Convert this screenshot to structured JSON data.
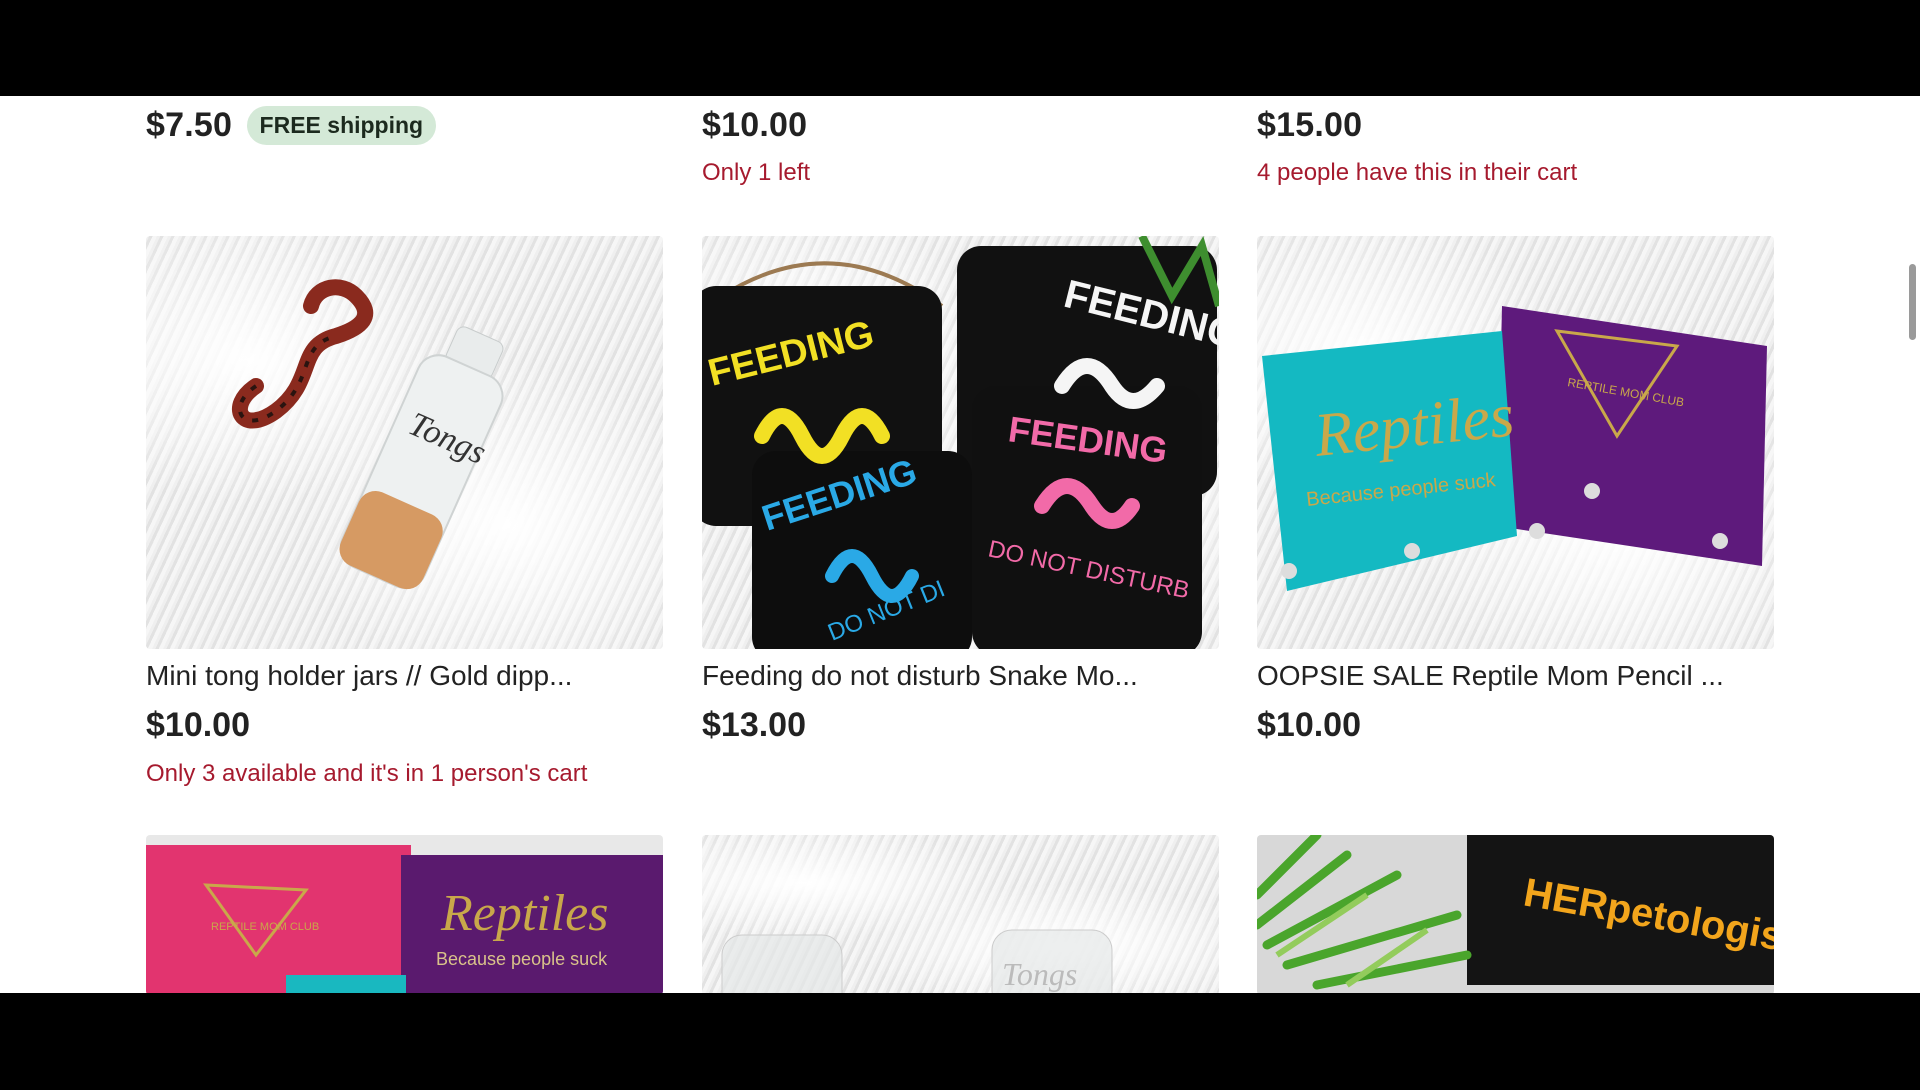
{
  "previous_row": [
    {
      "price": "$7.50",
      "badge": "FREE shipping",
      "note": ""
    },
    {
      "price": "$10.00",
      "badge": "",
      "note": "Only 1 left"
    },
    {
      "price": "$15.00",
      "badge": "",
      "note": "4 people have this in their cart"
    }
  ],
  "listings": [
    {
      "title": "Mini tong holder jars // Gold dipp...",
      "price": "$10.00",
      "note": "Only 3 available and it's in 1 person's cart",
      "image_text": [
        "Tongs"
      ]
    },
    {
      "title": "Feeding do not disturb Snake Mo...",
      "price": "$13.00",
      "note": "",
      "image_text": [
        "FEEDING",
        "FEEDING",
        "FEEDING",
        "FEEDING",
        "DO NOT DISTURB",
        "DO NOT DI"
      ]
    },
    {
      "title": "OOPSIE SALE Reptile Mom Pencil ...",
      "price": "$10.00",
      "note": "",
      "image_text": [
        "Reptiles",
        "Because people suck",
        "REPTILE MOM CLUB"
      ]
    }
  ],
  "next_row_images": [
    {
      "image_text": [
        "REPTILE MOM CLUB",
        "Reptiles",
        "Because people suck"
      ]
    },
    {
      "image_text": [
        "Tongs"
      ]
    },
    {
      "image_text": [
        "HERpetologist"
      ]
    }
  ],
  "colors": {
    "accent_red": "#a61a2e",
    "badge_green": "#d4e9d7"
  }
}
